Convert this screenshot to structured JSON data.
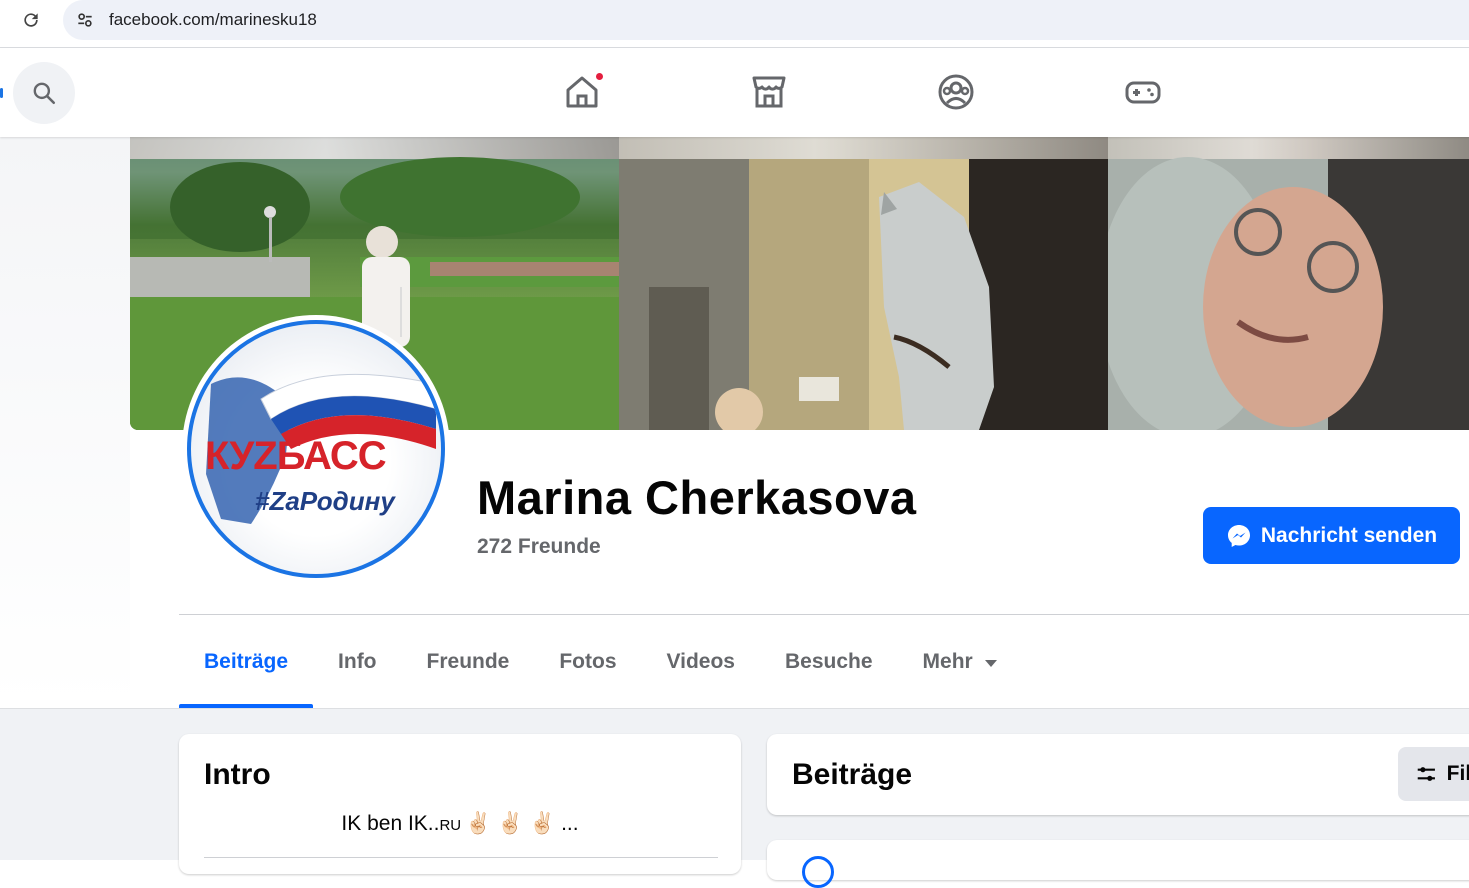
{
  "browser": {
    "url": "facebook.com/marinesku18"
  },
  "nav": {
    "icons": [
      "home-icon",
      "marketplace-icon",
      "groups-icon",
      "gaming-icon"
    ],
    "home_has_notification": true
  },
  "profile": {
    "name": "Marina Cherkasova",
    "friends": "272 Freunde",
    "message_button": "Nachricht senden",
    "avatar_text_top": "КУZБАСС",
    "avatar_text_bottom": "#ZаРодину"
  },
  "tabs": [
    {
      "label": "Beiträge",
      "active": true
    },
    {
      "label": "Info",
      "active": false
    },
    {
      "label": "Freunde",
      "active": false
    },
    {
      "label": "Fotos",
      "active": false
    },
    {
      "label": "Videos",
      "active": false
    },
    {
      "label": "Besuche",
      "active": false
    },
    {
      "label": "Mehr",
      "active": false
    }
  ],
  "intro": {
    "title": "Intro",
    "bio_main": "IK ben IK..",
    "bio_small": "RU",
    "bio_emoji": "✌🏻 ✌🏻 ✌🏻 ..."
  },
  "posts": {
    "title": "Beiträge",
    "filter_label": "Filter"
  },
  "colors": {
    "accent": "#0866ff",
    "notification": "#e41e3f",
    "secondary_text": "#65676b"
  }
}
